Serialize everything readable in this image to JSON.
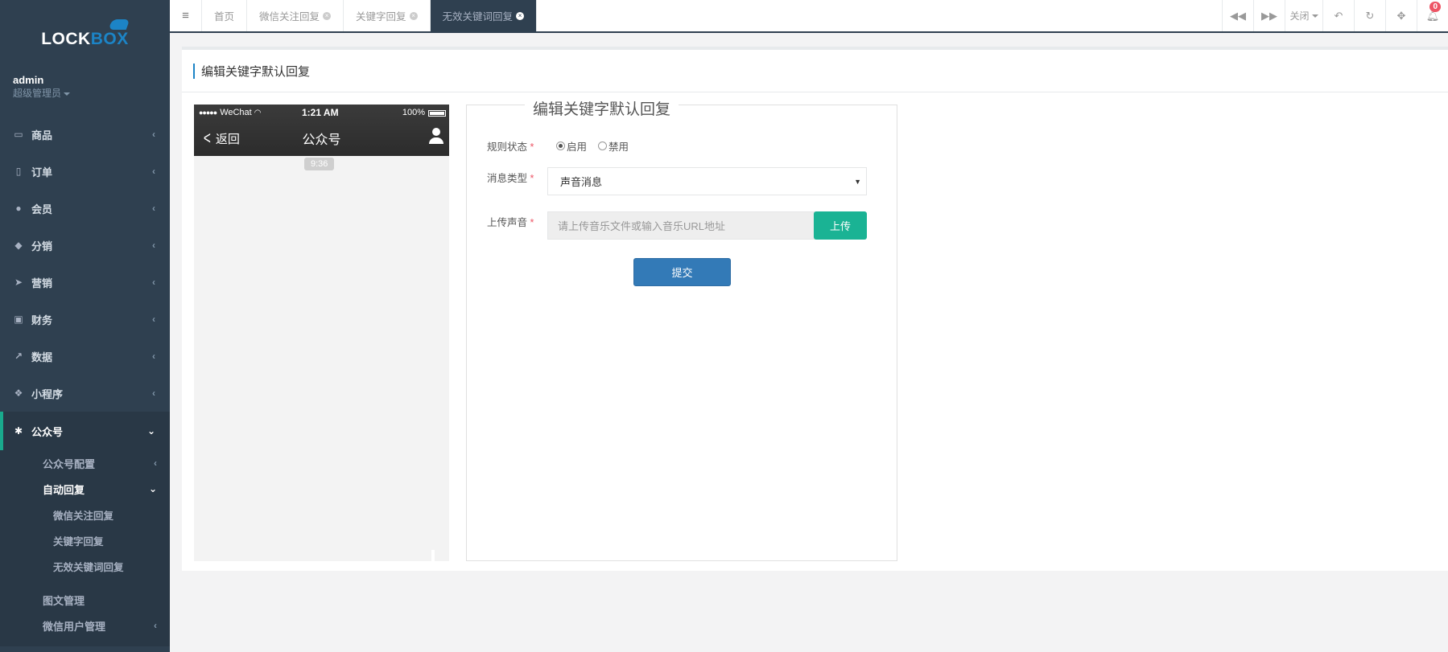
{
  "sidebar": {
    "logo": {
      "part1": "LOCK",
      "part2": "BOX"
    },
    "user": {
      "name": "admin",
      "role": "超级管理员"
    },
    "items": [
      {
        "label": "商品",
        "icon": "laptop-icon"
      },
      {
        "label": "订单",
        "icon": "receipt-icon"
      },
      {
        "label": "会员",
        "icon": "user-icon"
      },
      {
        "label": "分销",
        "icon": "users-icon"
      },
      {
        "label": "营销",
        "icon": "paper-plane-icon"
      },
      {
        "label": "财务",
        "icon": "money-icon"
      },
      {
        "label": "数据",
        "icon": "line-chart-icon"
      },
      {
        "label": "小程序",
        "icon": "cubes-icon"
      }
    ],
    "active": {
      "label": "公众号",
      "icon": "wechat-icon",
      "sub": [
        {
          "label": "公众号配置"
        },
        {
          "label": "自动回复"
        }
      ],
      "sub2": [
        {
          "label": "微信关注回复"
        },
        {
          "label": "关键字回复"
        },
        {
          "label": "无效关键词回复"
        }
      ],
      "after": [
        {
          "label": "图文管理"
        },
        {
          "label": "微信用户管理"
        }
      ]
    }
  },
  "topbar": {
    "tabs": [
      {
        "label": "首页"
      },
      {
        "label": "微信关注回复"
      },
      {
        "label": "关键字回复"
      },
      {
        "label": "无效关键词回复"
      }
    ],
    "close_label": "关闭",
    "notification_count": "0"
  },
  "page": {
    "title": "编辑关键字默认回复"
  },
  "phone": {
    "carrier": "WeChat",
    "time": "1:21 AM",
    "battery": "100%",
    "back_label": "返回",
    "title": "公众号",
    "message_time": "9:36"
  },
  "form": {
    "legend": "编辑关键字默认回复",
    "status_label": "规则状态",
    "status_options": [
      "启用",
      "禁用"
    ],
    "type_label": "消息类型",
    "type_value": "声音消息",
    "upload_label": "上传声音",
    "upload_placeholder": "请上传音乐文件或输入音乐URL地址",
    "upload_button": "上传",
    "submit_button": "提交"
  },
  "colors": {
    "sidebar_bg": "#2f4050",
    "accent_green": "#1ab394",
    "primary_blue": "#337ab7",
    "logo_blue": "#1c84c6"
  }
}
